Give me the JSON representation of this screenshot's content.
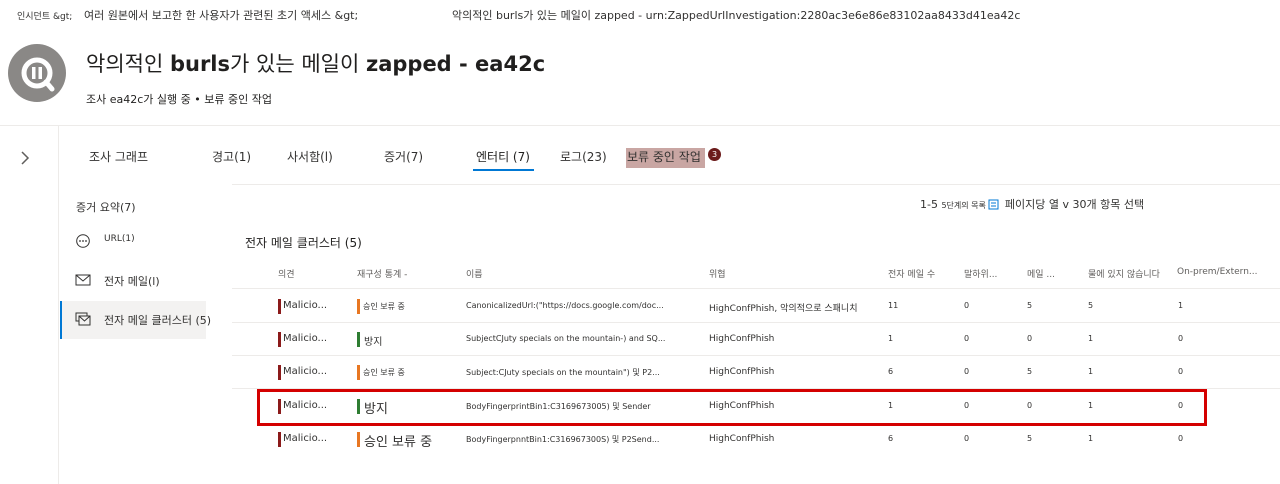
{
  "colors": {
    "accent": "#0078d4",
    "severity_bar": "#8b1a1a",
    "status_pending": "#e87722",
    "status_prevented": "#2e7d32",
    "badge": "#6b1a1a",
    "highlight_box": "#d40000"
  },
  "breadcrumb": {
    "incidents": "인시던트 &gt;",
    "incident_name": "여러 원본에서 보고한 한 사용자가 관련된 초기 액세스 &gt;",
    "investigation": "악의적인 burls가 있는 메일이 zapped - urn:ZappedUrlInvestigation:2280ac3e6e86e83102aa8433d41ea42c"
  },
  "header": {
    "title_prefix": "악의적인",
    "title_bold1": "burls",
    "title_middle": "가 있는 메일이",
    "title_bold2": "zapped - ea42c",
    "subtitle": "조사 ea42c가 실행 중 • 보류 중인 작업",
    "logo_icon": "investigation-pause-icon"
  },
  "tabs": [
    {
      "label": "조사 그래프"
    },
    {
      "label": "경고(1)"
    },
    {
      "label": "사서함(l)"
    },
    {
      "label": "증거(7)"
    },
    {
      "label": "엔터티 (7)"
    },
    {
      "label": "로그(23)"
    },
    {
      "label": "보류 중인 작업",
      "badge": "3"
    }
  ],
  "sidebar": {
    "summary": "증거 요약(7)",
    "items": [
      {
        "label": "URL(1)",
        "icon": "url-ellipsis-icon"
      },
      {
        "label": "전자 메일(l)",
        "icon": "mail-icon"
      },
      {
        "label": "전자 메일 클러스터 (5)",
        "icon": "mail-cluster-icon"
      }
    ]
  },
  "paging": {
    "range": "1-5",
    "small": "5단계의 목록",
    "per_page": "페이지당 열 v 30개 항목 선택"
  },
  "section": {
    "title": "전자 메일 클러스터 (5)"
  },
  "table": {
    "columns": [
      "의견",
      "재구성 통계 -",
      "이름",
      "위협",
      "전자 메일 수",
      "말하위...",
      "메일 ...",
      "물에 있지 않습니다",
      "On-prem/Extern..."
    ],
    "rows": [
      {
        "verdict": "Malicio...",
        "status": "승인 보류 중",
        "status_color": "pending",
        "name": "CanonicalizedUrl:(\"https://docs.google.com/doc...",
        "threat": "HighConfPhish, 악의적으로 스패니치",
        "emails": "11",
        "c6": "0",
        "c7": "5",
        "c8": "5",
        "c9": "1"
      },
      {
        "verdict": "Malicio...",
        "status": "방지",
        "status_color": "prevented",
        "name": "SubjectCJuty specials on the mountain-) and SQ...",
        "threat": "HighConfPhish",
        "emails": "1",
        "c6": "0",
        "c7": "0",
        "c8": "1",
        "c9": "0"
      },
      {
        "verdict": "Malicio...",
        "status": "승인 보류 중",
        "status_color": "pending",
        "name": "Subject:CJuty specials on the mountain\") 및 P2...",
        "threat": "HighConfPhish",
        "emails": "6",
        "c6": "0",
        "c7": "5",
        "c8": "1",
        "c9": "0"
      },
      {
        "verdict": "Malicio...",
        "status": "방지",
        "status_color": "prevented",
        "name": "BodyFingerprintBin1:C3169673005) 및 Sender",
        "threat": "HighConfPhish",
        "emails": "1",
        "c6": "0",
        "c7": "0",
        "c8": "1",
        "c9": "0"
      },
      {
        "verdict": "Malicio...",
        "status": "승인 보류 중",
        "status_color": "pending",
        "name": "BodyFingerpnntBin1:C316967300S) 및 P2Send...",
        "threat": "HighConfPhish",
        "emails": "6",
        "c6": "0",
        "c7": "5",
        "c8": "1",
        "c9": "0"
      }
    ]
  }
}
